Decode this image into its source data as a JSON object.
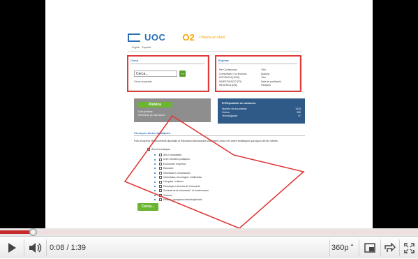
{
  "header": {
    "brand": "UOC",
    "o2": "O2",
    "o2_tagline": "/ Oberta en obert",
    "languages": "English · Español"
  },
  "search_panel": {
    "title": "Cerca",
    "input_value": "Cerca...",
    "go_label": "»»",
    "advanced_link": "Cerca avançada"
  },
  "explore_panel": {
    "title": "Explora",
    "col1": [
      "Per Col·leccions",
      "Comunitats i Col·leccions",
      "DOCÈNCIA [1040]",
      "INVESTIGACIÓ [73]",
      "RECERCA [105]"
    ],
    "col2": [
      "Títol",
      "Autor(s)",
      "Títol",
      "Data de publicació",
      "Paraules"
    ]
  },
  "publish": {
    "button_label": "Publica",
    "lines": [
      "Com publicar",
      "Informa-te per als autors"
    ]
  },
  "repository": {
    "title": "El Repositori en números",
    "rows": [
      {
        "label": "Nombre de documents",
        "value": "1433"
      },
      {
        "label": "Vídeos",
        "value": "305"
      },
      {
        "label": "Tecnològiques",
        "value": "47"
      }
    ]
  },
  "areas": {
    "title": "Cerca per àrees temàtiques",
    "description": "Pots recuperar els documents dipositats al Repositori seleccionant únicament l'àrea o les àrees temàtiques que siguin del teu interès:",
    "root_label": "Àrees temàtiques",
    "items": [
      "Arts i humanitats",
      "Dret i ciències polítiques",
      "Economia i empresa",
      "Educació",
      "Informació i comunicació",
      "Informàtica, tecnologia i multimèdia",
      "Llengües i cultures",
      "Psicologia i ciències de l'educació",
      "Societat de la informació i el coneixement",
      "Turisme",
      "Estudis i postgraus interdisciplinaris"
    ],
    "search_button": "Cerca..."
  },
  "player": {
    "time_current": "0:08",
    "time_separator": " / ",
    "time_total": "1:39",
    "quality": "360p",
    "progress_fraction": 0.0808,
    "icons": {
      "play": "play-icon",
      "volume": "volume-icon",
      "popout": "popout-icon",
      "expand": "expand-icon",
      "fullscreen": "fullscreen-icon"
    },
    "colors": {
      "played": "#c62a2a",
      "highlight": "#e03a3a"
    }
  }
}
